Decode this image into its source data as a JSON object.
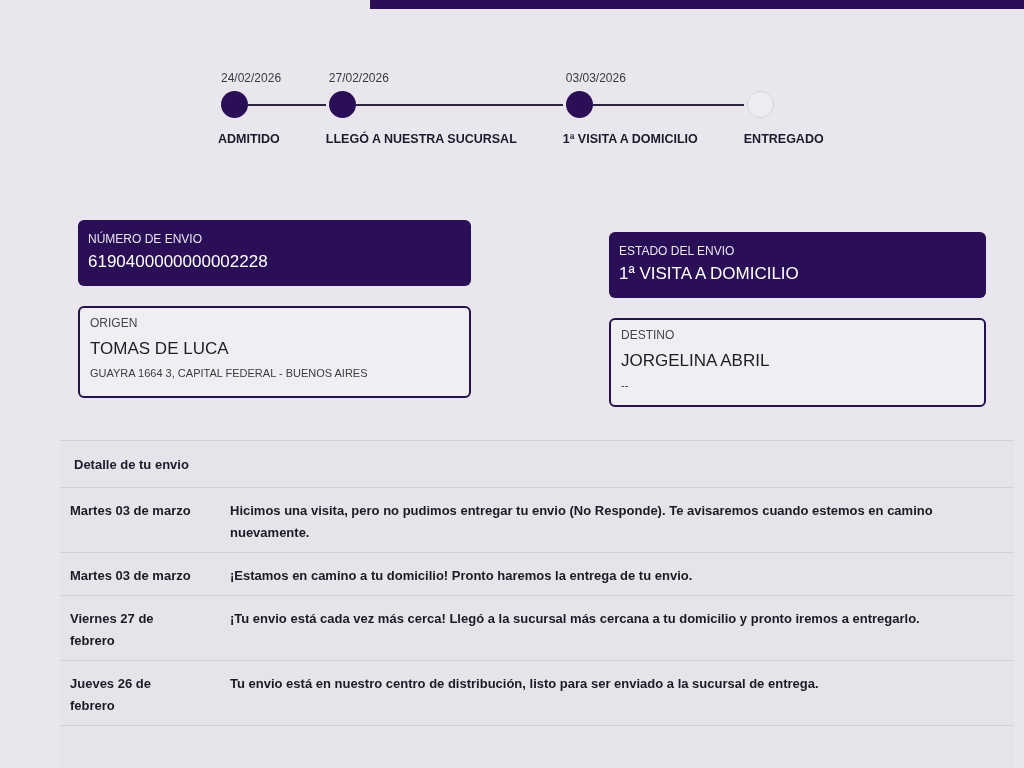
{
  "progress": {
    "steps": [
      {
        "date": "24/02/2026",
        "label": "ADMITIDO",
        "completed": true
      },
      {
        "date": "27/02/2026",
        "label": "LLEGÓ A NUESTRA SUCURSAL",
        "completed": true
      },
      {
        "date": "03/03/2026",
        "label": "1ª VISITA A DOMICILIO",
        "completed": true
      },
      {
        "label": "ENTREGADO",
        "completed": false
      }
    ]
  },
  "shipment_number": {
    "label": "NÚMERO DE ENVIO",
    "value": "6190400000000002228"
  },
  "origin": {
    "label": "ORIGEN",
    "name": "TOMAS DE LUCA",
    "address": "GUAYRA 1664 3, CAPITAL FEDERAL - BUENOS AIRES"
  },
  "status": {
    "label": "ESTADO DEL ENVIO",
    "value": "1ª VISITA A DOMICILIO"
  },
  "destination": {
    "label": "DESTINO",
    "name": "JORGELINA ABRIL",
    "address": "--"
  },
  "details": {
    "title": "Detalle de tu envio",
    "rows": [
      {
        "date": "Martes 03 de marzo",
        "text": "Hicimos una visita, pero no pudimos entregar tu envio (No Responde). Te avisaremos cuando estemos en camino nuevamente."
      },
      {
        "date": "Martes 03 de marzo",
        "text": "¡Estamos en camino a tu domicilio! Pronto haremos la entrega de tu envio."
      },
      {
        "date": "Viernes 27 de febrero",
        "text": "¡Tu envio está cada vez más cerca! Llegó a la sucursal más cercana a tu domicilio y pronto iremos a entregarlo."
      },
      {
        "date": "Jueves 26 de febrero",
        "text": "Tu envio está en nuestro centro de distribución, listo para ser enviado a la sucursal de entrega."
      }
    ]
  }
}
